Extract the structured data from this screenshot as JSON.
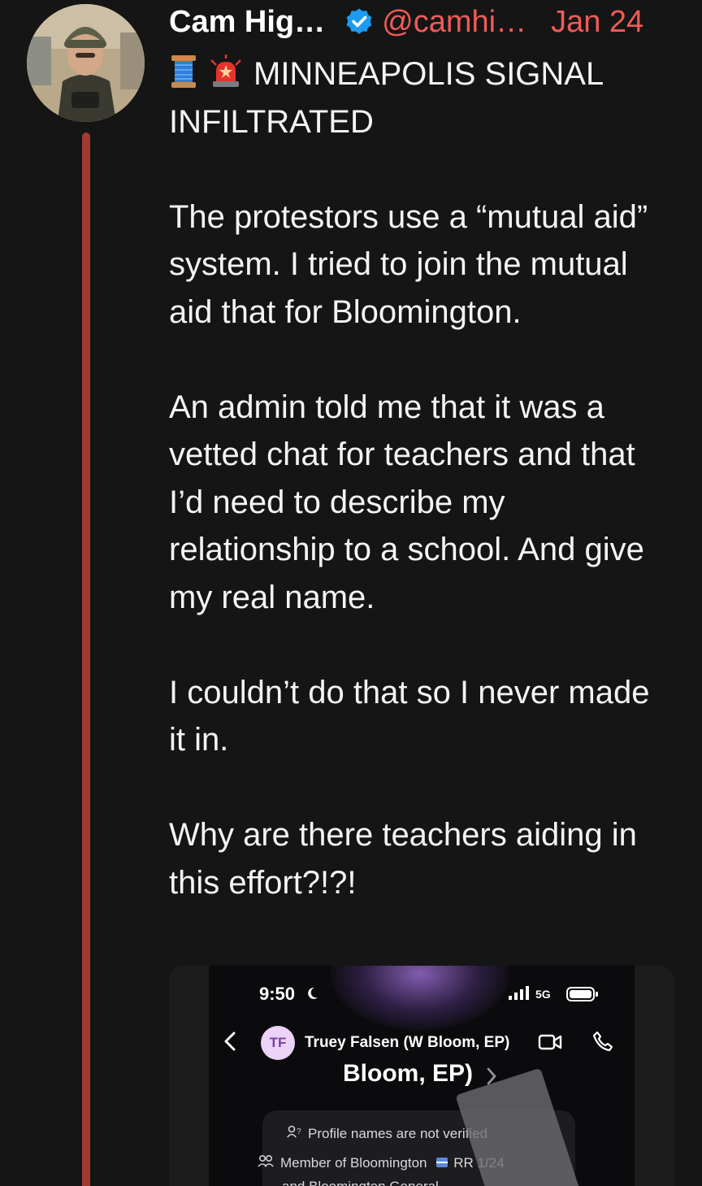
{
  "post": {
    "author_name": "Cam Hig…",
    "handle": "@camhi…",
    "date": "Jan 24",
    "paragraphs": [
      "MINNEAPOLIS SIGNAL INFILTRATED",
      "The protestors use a “mutual aid” system. I tried to join the mutual aid that for Bloomington.",
      "An admin told me that it was a vetted chat for teachers and that I’d need to describe my relationship to a school. And give my real name.",
      "I couldn’t do that so I never made it in.",
      "Why are there teachers aiding in this effort?!?!"
    ],
    "emojis": [
      "thread-spool-icon",
      "police-light-icon"
    ]
  },
  "screenshot": {
    "status_time": "9:50",
    "network": "5G",
    "contact_initials": "TF",
    "contact_name": "Truey Falsen (W Bloom, EP)",
    "large_name": "Bloom, EP)",
    "profile_notice": "Profile names are not verified",
    "member_of": "Member of Bloomington",
    "member_badge": "RR 1/24",
    "member_more": "and Bloomington General"
  },
  "colors": {
    "background": "#151515",
    "accent": "#ef5b57",
    "thread_line": "#a03a35",
    "verified": "#1d9bf0"
  }
}
